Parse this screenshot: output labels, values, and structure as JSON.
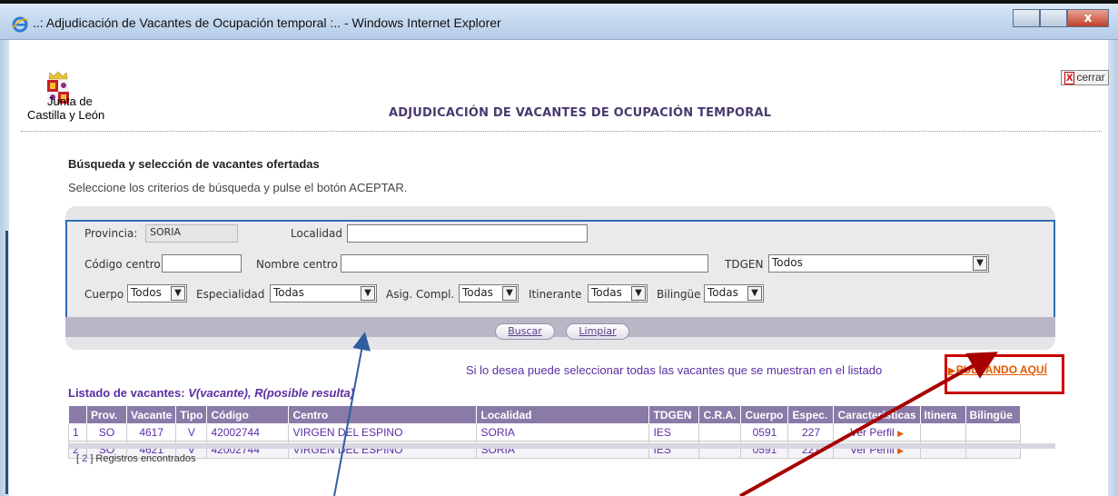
{
  "window": {
    "title": "..: Adjudicación de Vacantes de Ocupación temporal :.. - Windows Internet Explorer",
    "close_glyph": "x"
  },
  "logo": {
    "line1": "Junta de",
    "line2": "Castilla y León"
  },
  "close_link": {
    "icon": "X",
    "label": "cerrar"
  },
  "page_title": "ADJUDICACIÓN DE VACANTES DE OCUPACIÓN TEMPORAL",
  "search": {
    "title": "Búsqueda y selección de vacantes ofertadas",
    "subtitle": "Seleccione los criterios de búsqueda y pulse el botón ACEPTAR.",
    "provincia_label": "Provincia:",
    "provincia_value": "SORIA",
    "localidad_label": "Localidad",
    "localidad_value": "",
    "codigo_label": "Código centro",
    "codigo_value": "",
    "nombre_label": "Nombre centro",
    "nombre_value": "",
    "tdgen_label": "TDGEN",
    "tdgen_value": "Todos",
    "cuerpo_label": "Cuerpo",
    "cuerpo_value": "Todos",
    "especialidad_label": "Especialidad",
    "especialidad_value": "Todas",
    "asig_label": "Asig. Compl.",
    "asig_value": "Todas",
    "itinerante_label": "Itinerante",
    "itinerante_value": "Todas",
    "bilingue_label": "Bilingüe",
    "bilingue_value": "Todas",
    "buscar_label": "Buscar",
    "limpiar_label": "Limpiar"
  },
  "select_all": {
    "text": "Si lo desea puede seleccionar todas las vacantes que se muestran en el listado",
    "link": "PULSANDO AQUÍ"
  },
  "list": {
    "title": "Listado de vacantes:",
    "legend": "V(vacante), R(posible resulta)",
    "columns": [
      "",
      "Prov.",
      "Vacante",
      "Tipo",
      "Código",
      "Centro",
      "Localidad",
      "TDGEN",
      "C.R.A.",
      "Cuerpo",
      "Espec.",
      "Características",
      "Itinera",
      "Bilingüe"
    ],
    "rows": [
      {
        "n": "1",
        "prov": "SO",
        "vacante": "4617",
        "tipo": "V",
        "codigo": "42002744",
        "centro": "VIRGEN DEL ESPINO",
        "localidad": "SORIA",
        "tdgen": "IES",
        "cra": "",
        "cuerpo": "0591",
        "espec": "227",
        "caract": "Ver Perfil",
        "itinera": "",
        "bilingue": ""
      },
      {
        "n": "2",
        "prov": "SO",
        "vacante": "4621",
        "tipo": "V",
        "codigo": "42002744",
        "centro": "VIRGEN DEL ESPINO",
        "localidad": "SORIA",
        "tdgen": "IES",
        "cra": "",
        "cuerpo": "0591",
        "espec": "227",
        "caract": "Ver Perfil",
        "itinera": "",
        "bilingue": ""
      }
    ],
    "count_open": "[",
    "count": "2",
    "count_close": "] Registros encontrados"
  },
  "colors": {
    "accent_purple": "#5a2fa2",
    "header_purple": "#8a7aa8",
    "highlight_red": "#c00000",
    "panel_border_blue": "#2e6db4",
    "link_orange": "#e25a00"
  }
}
